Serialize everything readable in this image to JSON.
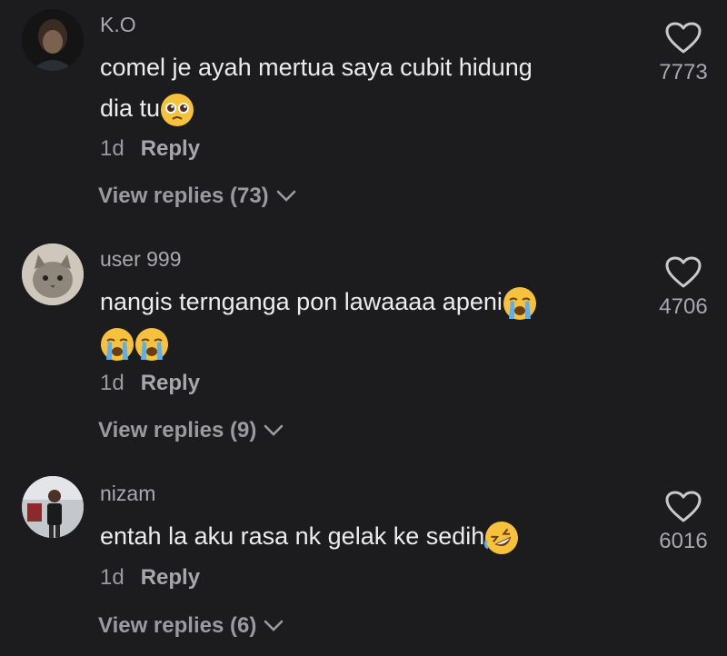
{
  "comments": [
    {
      "username": "K.O",
      "text_line1": "comel je ayah mertua saya cubit hidung",
      "text_line2": "dia tu",
      "emoji": "pleading-face",
      "time": "1d",
      "reply_label": "Reply",
      "view_replies": "View replies (73)",
      "likes": "7773",
      "avatar": "person-avatar"
    },
    {
      "username": "user 999",
      "text_line1": "nangis ternganga pon lawaaaa apeni",
      "emoji": "loudly-crying-face",
      "time": "1d",
      "reply_label": "Reply",
      "view_replies": "View replies (9)",
      "likes": "4706",
      "avatar": "cat-avatar"
    },
    {
      "username": "nizam",
      "text_line1": "entah la aku rasa nk gelak ke sedih",
      "emoji": "rolling-on-floor-laughing-face",
      "time": "1d",
      "reply_label": "Reply",
      "view_replies": "View replies (6)",
      "likes": "6016",
      "avatar": "person-avatar"
    }
  ],
  "colors": {
    "background": "#1c1c1e",
    "text": "#ececec",
    "muted": "#9b9b9f",
    "emoji": "#f7c23b"
  }
}
